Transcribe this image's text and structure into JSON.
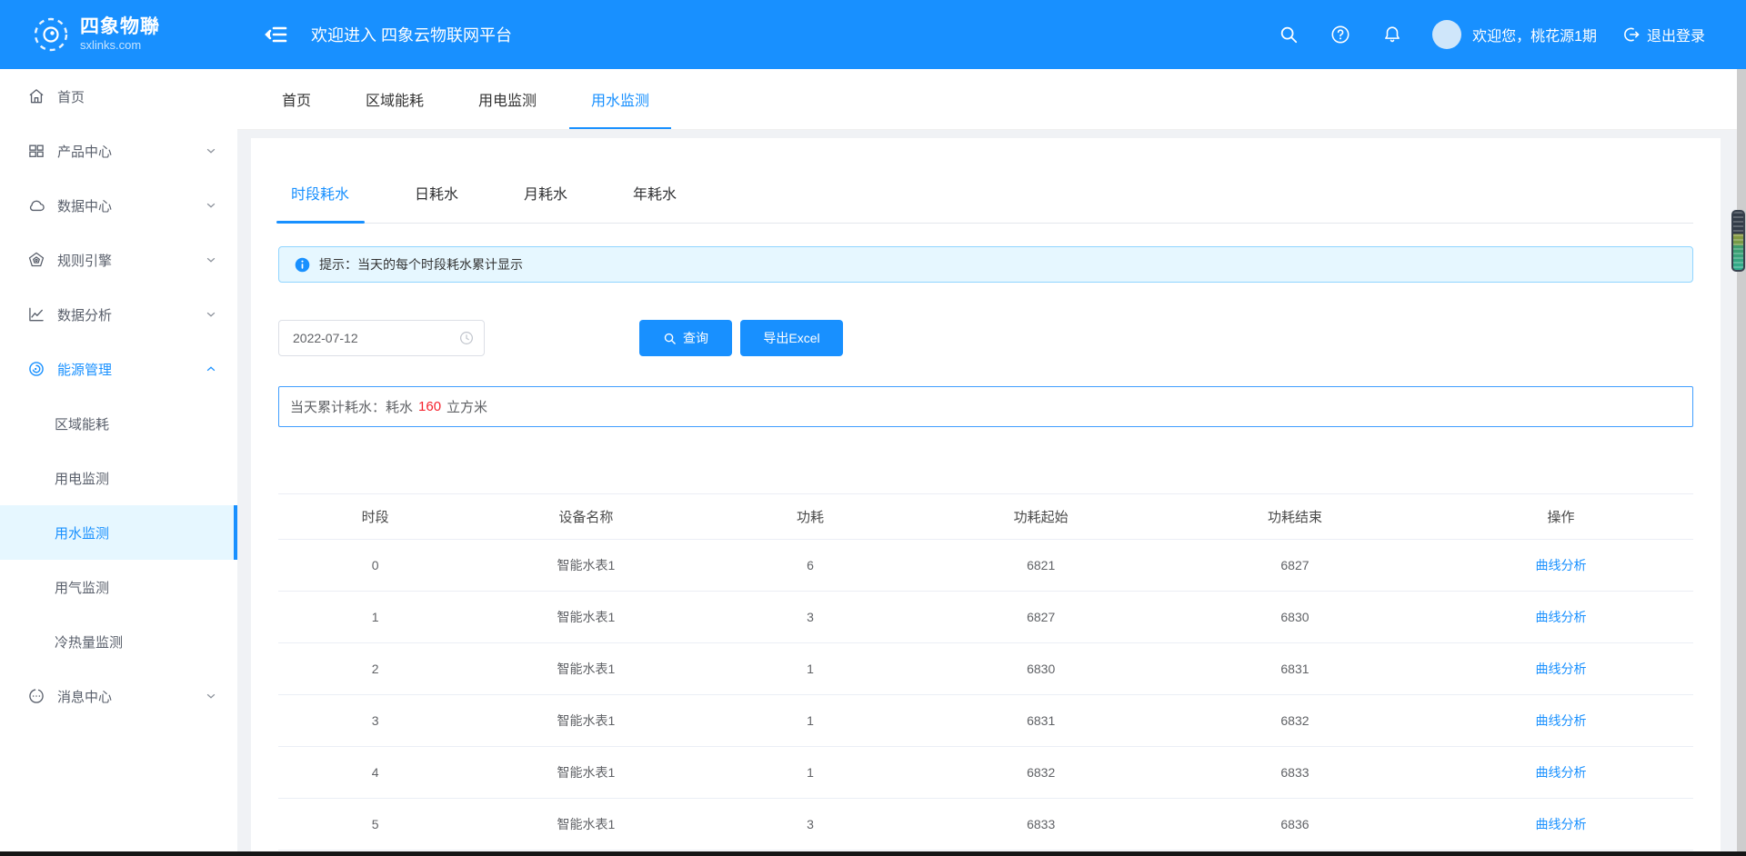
{
  "brand": {
    "title": "四象物聯",
    "subtitle": "sxlinks.com"
  },
  "header": {
    "welcome_title": "欢迎进入 四象云物联网平台",
    "greeting": "欢迎您，桃花源1期",
    "logout_label": "退出登录"
  },
  "page_tabs": {
    "items": [
      {
        "label": "首页",
        "active": false
      },
      {
        "label": "区域能耗",
        "active": false
      },
      {
        "label": "用电监测",
        "active": false
      },
      {
        "label": "用水监测",
        "active": true
      }
    ]
  },
  "sidebar": {
    "items": [
      {
        "label": "首页",
        "icon": "home-icon",
        "expandable": false
      },
      {
        "label": "产品中心",
        "icon": "product-grid-icon",
        "expandable": true,
        "expanded": false
      },
      {
        "label": "数据中心",
        "icon": "cloud-icon",
        "expandable": true,
        "expanded": false
      },
      {
        "label": "规则引擎",
        "icon": "rule-badge-icon",
        "expandable": true,
        "expanded": false
      },
      {
        "label": "数据分析",
        "icon": "chart-line-icon",
        "expandable": true,
        "expanded": false
      },
      {
        "label": "能源管理",
        "icon": "energy-gauge-icon",
        "expandable": true,
        "expanded": true,
        "active": true
      },
      {
        "label": "消息中心",
        "icon": "message-bubble-icon",
        "expandable": true,
        "expanded": false
      }
    ],
    "energy_children": [
      {
        "label": "区域能耗",
        "active": false
      },
      {
        "label": "用电监测",
        "active": false
      },
      {
        "label": "用水监测",
        "active": true
      },
      {
        "label": "用气监测",
        "active": false
      },
      {
        "label": "冷热量监测",
        "active": false
      }
    ]
  },
  "content_tabs": {
    "items": [
      {
        "label": "时段耗水",
        "active": true
      },
      {
        "label": "日耗水",
        "active": false
      },
      {
        "label": "月耗水",
        "active": false
      },
      {
        "label": "年耗水",
        "active": false
      }
    ]
  },
  "hint": {
    "text": "提示：当天的每个时段耗水累计显示"
  },
  "query": {
    "date_value": "2022-07-12",
    "search_label": "查询",
    "export_label": "导出Excel"
  },
  "summary": {
    "prefix": "当天累计耗水：耗水",
    "value": "160",
    "suffix": "立方米"
  },
  "table": {
    "columns": [
      "时段",
      "设备名称",
      "功耗",
      "功耗起始",
      "功耗结束",
      "操作"
    ],
    "action_label": "曲线分析",
    "rows": [
      {
        "cells": [
          "0",
          "智能水表1",
          "6",
          "6821",
          "6827"
        ]
      },
      {
        "cells": [
          "1",
          "智能水表1",
          "3",
          "6827",
          "6830"
        ]
      },
      {
        "cells": [
          "2",
          "智能水表1",
          "1",
          "6830",
          "6831"
        ]
      },
      {
        "cells": [
          "3",
          "智能水表1",
          "1",
          "6831",
          "6832"
        ]
      },
      {
        "cells": [
          "4",
          "智能水表1",
          "1",
          "6832",
          "6833"
        ]
      },
      {
        "cells": [
          "5",
          "智能水表1",
          "3",
          "6833",
          "6836"
        ]
      }
    ]
  },
  "colors": {
    "primary": "#1890ff",
    "alert_bg": "#e6f7ff",
    "alert_border": "#91d5ff",
    "danger": "#f5222d",
    "sidebar_active_bg": "#e6f7ff"
  }
}
